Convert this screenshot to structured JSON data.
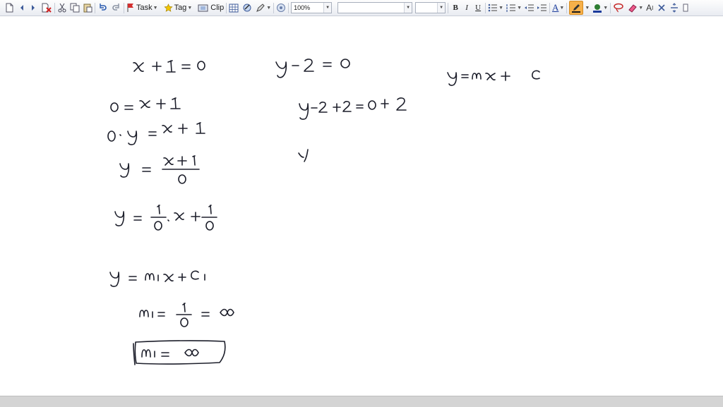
{
  "toolbar": {
    "task_label": "Task",
    "tag_label": "Tag",
    "clip_label": "Clip",
    "zoom_value": "100%",
    "font_family_value": "",
    "font_size_value": "",
    "bold_label": "B",
    "italic_label": "I",
    "underline_label": "U",
    "text_label": "A",
    "format_label": "A"
  },
  "colors": {
    "pen_highlight": "#f6b04a",
    "task_flag": "#d32f2f",
    "tag_star": "#e5b100",
    "font_color": "#1a3a9b",
    "highlighter": "#2e7d32",
    "eraser": "#d81b60"
  },
  "icons": [
    "new-page-icon",
    "back-icon",
    "forward-icon",
    "delete-page-icon",
    "cut-icon",
    "copy-icon",
    "paste-icon",
    "undo-icon",
    "redo-icon",
    "flag-icon",
    "star-icon",
    "clip-icon",
    "table-icon",
    "insert-icon",
    "pen-icon",
    "snapshot-icon",
    "bullets-icon",
    "numbering-icon",
    "outdent-icon",
    "indent-icon",
    "pen-color-icon",
    "font-color-icon",
    "lasso-icon",
    "eraser-icon",
    "format-icon",
    "close-icon",
    "split-icon"
  ]
}
